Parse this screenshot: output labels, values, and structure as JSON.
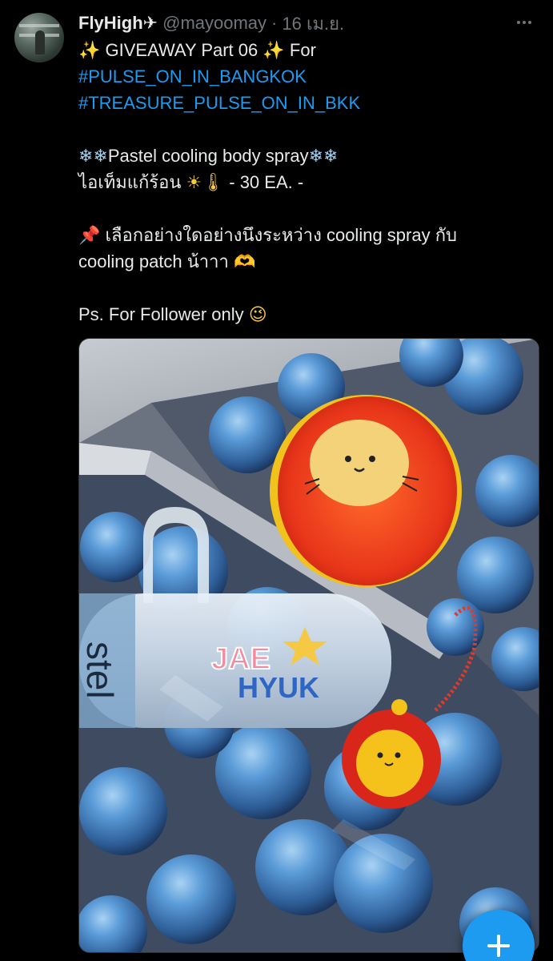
{
  "tweet": {
    "display_name": "FlyHigh",
    "name_emoji": "✈",
    "handle": "@mayoomay",
    "separator": "·",
    "date": "16 เม.ย.",
    "lines": {
      "line1_sparkle_a": "✨",
      "line1_text": " GIVEAWAY  Part 06 ",
      "line1_sparkle_b": "✨",
      "line1_tail": " For",
      "hashtag1": "#PULSE_ON_IN_BANGKOK",
      "hashtag2": "#TREASURE_PULSE_ON_IN_BKK",
      "line3_snow_a": "❄❄",
      "line3_text": "Pastel cooling body spray",
      "line3_snow_b": "❄❄",
      "line4_text": "ไอเท็มแก้ร้อน ",
      "line4_emoji": "☀🌡",
      "line4_tail": "  - 30 EA. -",
      "line5_pin": "📌",
      "line5_text": " เลือกอย่างใดอย่างนึงระหว่าง cooling spray กับ",
      "line6_text": "cooling patch น้าาา ",
      "line6_emoji": "🫶",
      "line7_text": "Ps. For Follower only ",
      "line7_emoji": "😉"
    }
  },
  "media": {
    "bottle_name_a": "JAE",
    "bottle_name_b": "HYUK",
    "bottle_brand": "stel",
    "description": ""
  },
  "fab": {
    "icon": "plus-icon"
  },
  "colors": {
    "background": "#000000",
    "text": "#e7e9ea",
    "secondary": "#71767b",
    "link": "#1d9bf0",
    "fab": "#1d9bf0"
  }
}
